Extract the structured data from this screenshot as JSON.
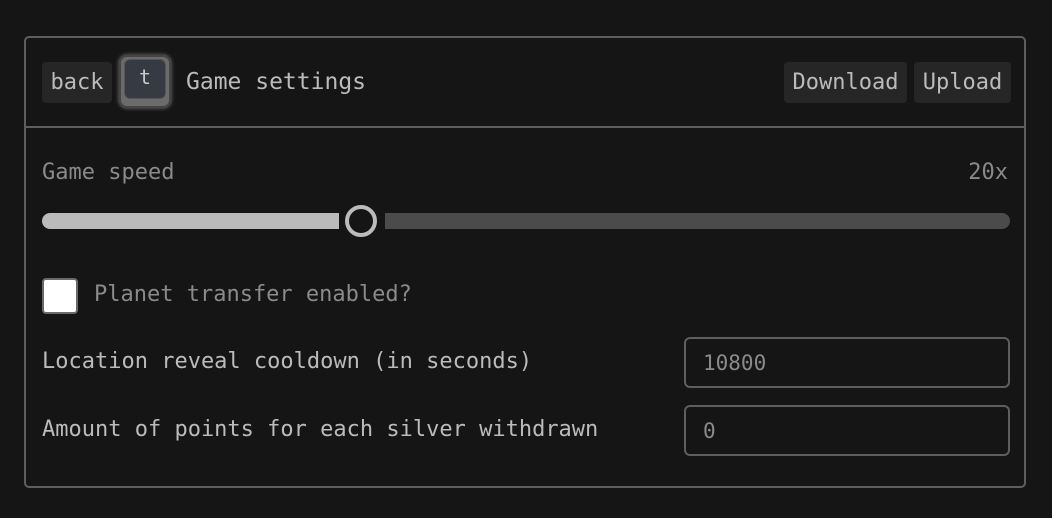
{
  "header": {
    "back_label": "back",
    "shortcut_key": "t",
    "title": "Game settings",
    "download_label": "Download",
    "upload_label": "Upload"
  },
  "settings": {
    "game_speed": {
      "label": "Game speed",
      "value_text": "20x",
      "slider_fraction": 0.33
    },
    "planet_transfer": {
      "label": "Planet transfer enabled?",
      "checked": false
    },
    "location_reveal_cooldown": {
      "label": "Location reveal cooldown (in seconds)",
      "value": "10800"
    },
    "points_per_silver": {
      "label": "Amount of points for each silver withdrawn",
      "value": "0"
    }
  },
  "colors": {
    "background": "#151515",
    "border": "#5e5e5e",
    "text": "#bbbbbb",
    "muted_text": "#8a8a8a",
    "button_bg": "#262626",
    "slider_fill": "#bbbbbb",
    "slider_rest": "#4b4b4b"
  }
}
